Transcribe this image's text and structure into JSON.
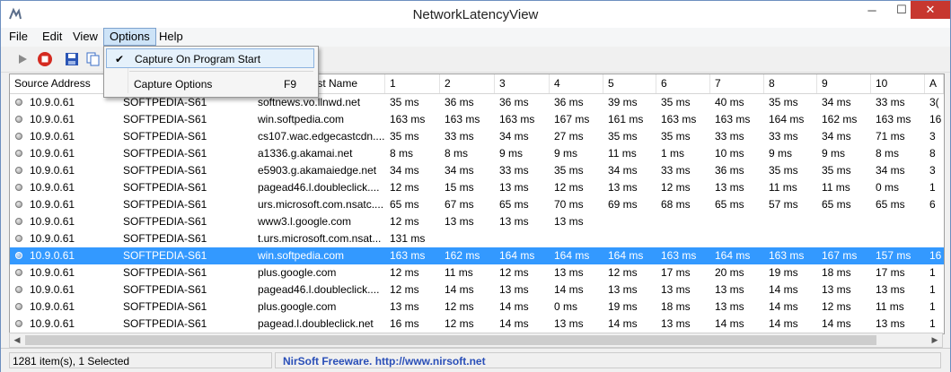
{
  "window": {
    "title": "NetworkLatencyView",
    "minimize": "─",
    "maximize": "☐",
    "close": "✕"
  },
  "menu": {
    "items": [
      "File",
      "Edit",
      "View",
      "Options",
      "Help"
    ]
  },
  "dropdown": {
    "items": [
      {
        "label": "Capture On Program Start",
        "shortcut": "",
        "checked": true
      },
      {
        "label": "Capture Options",
        "shortcut": "F9",
        "checked": false
      }
    ],
    "check_glyph": "✔"
  },
  "table": {
    "columns": [
      "Source Address",
      "",
      "Host Name",
      "1",
      "2",
      "3",
      "4",
      "5",
      "6",
      "7",
      "8",
      "9",
      "10",
      "A"
    ],
    "rows": [
      [
        "10.9.0.61",
        "SOFTPEDIA-S61",
        "softnews.vo.llnwd.net",
        "35 ms",
        "36 ms",
        "36 ms",
        "36 ms",
        "39 ms",
        "35 ms",
        "40 ms",
        "35 ms",
        "34 ms",
        "33 ms",
        "3("
      ],
      [
        "10.9.0.61",
        "SOFTPEDIA-S61",
        "win.softpedia.com",
        "163 ms",
        "163 ms",
        "163 ms",
        "167 ms",
        "161 ms",
        "163 ms",
        "163 ms",
        "164 ms",
        "162 ms",
        "163 ms",
        "16"
      ],
      [
        "10.9.0.61",
        "SOFTPEDIA-S61",
        "cs107.wac.edgecastcdn....",
        "35 ms",
        "33 ms",
        "34 ms",
        "27 ms",
        "35 ms",
        "35 ms",
        "33 ms",
        "33 ms",
        "34 ms",
        "71 ms",
        "3"
      ],
      [
        "10.9.0.61",
        "SOFTPEDIA-S61",
        "a1336.g.akamai.net",
        "8 ms",
        "8 ms",
        "9 ms",
        "9 ms",
        "11 ms",
        "1 ms",
        "10 ms",
        "9 ms",
        "9 ms",
        "8 ms",
        "8"
      ],
      [
        "10.9.0.61",
        "SOFTPEDIA-S61",
        "e5903.g.akamaiedge.net",
        "34 ms",
        "34 ms",
        "33 ms",
        "35 ms",
        "34 ms",
        "33 ms",
        "36 ms",
        "35 ms",
        "35 ms",
        "34 ms",
        "3"
      ],
      [
        "10.9.0.61",
        "SOFTPEDIA-S61",
        "pagead46.l.doubleclick....",
        "12 ms",
        "15 ms",
        "13 ms",
        "12 ms",
        "13 ms",
        "12 ms",
        "13 ms",
        "11 ms",
        "11 ms",
        "0 ms",
        "1"
      ],
      [
        "10.9.0.61",
        "SOFTPEDIA-S61",
        "urs.microsoft.com.nsatc....",
        "65 ms",
        "67 ms",
        "65 ms",
        "70 ms",
        "69 ms",
        "68 ms",
        "65 ms",
        "57 ms",
        "65 ms",
        "65 ms",
        "6"
      ],
      [
        "10.9.0.61",
        "SOFTPEDIA-S61",
        "www3.l.google.com",
        "12 ms",
        "13 ms",
        "13 ms",
        "13 ms",
        "",
        "",
        "",
        "",
        "",
        "",
        ""
      ],
      [
        "10.9.0.61",
        "SOFTPEDIA-S61",
        "t.urs.microsoft.com.nsat...",
        "131 ms",
        "",
        "",
        "",
        "",
        "",
        "",
        "",
        "",
        "",
        ""
      ],
      [
        "10.9.0.61",
        "SOFTPEDIA-S61",
        "win.softpedia.com",
        "163 ms",
        "162 ms",
        "164 ms",
        "164 ms",
        "164 ms",
        "163 ms",
        "164 ms",
        "163 ms",
        "167 ms",
        "157 ms",
        "16"
      ],
      [
        "10.9.0.61",
        "SOFTPEDIA-S61",
        "plus.google.com",
        "12 ms",
        "11 ms",
        "12 ms",
        "13 ms",
        "12 ms",
        "17 ms",
        "20 ms",
        "19 ms",
        "18 ms",
        "17 ms",
        "1"
      ],
      [
        "10.9.0.61",
        "SOFTPEDIA-S61",
        "pagead46.l.doubleclick....",
        "12 ms",
        "14 ms",
        "13 ms",
        "14 ms",
        "13 ms",
        "13 ms",
        "13 ms",
        "14 ms",
        "13 ms",
        "13 ms",
        "1"
      ],
      [
        "10.9.0.61",
        "SOFTPEDIA-S61",
        "plus.google.com",
        "13 ms",
        "12 ms",
        "14 ms",
        "0 ms",
        "19 ms",
        "18 ms",
        "13 ms",
        "14 ms",
        "12 ms",
        "11 ms",
        "1"
      ],
      [
        "10.9.0.61",
        "SOFTPEDIA-S61",
        "pagead.l.doubleclick.net",
        "16 ms",
        "12 ms",
        "14 ms",
        "13 ms",
        "14 ms",
        "13 ms",
        "14 ms",
        "14 ms",
        "14 ms",
        "13 ms",
        "1"
      ]
    ],
    "selected_index": 9
  },
  "status": {
    "items": "1281 item(s), 1 Selected",
    "credit": "NirSoft Freeware.  http://www.nirsoft.net"
  },
  "toolbar": {
    "icons": [
      "play-icon",
      "stop-icon",
      "save-icon",
      "copy-icon"
    ]
  },
  "colors": {
    "selection": "#3399ff",
    "close": "#c7372f",
    "credit": "#2a4fb8"
  }
}
